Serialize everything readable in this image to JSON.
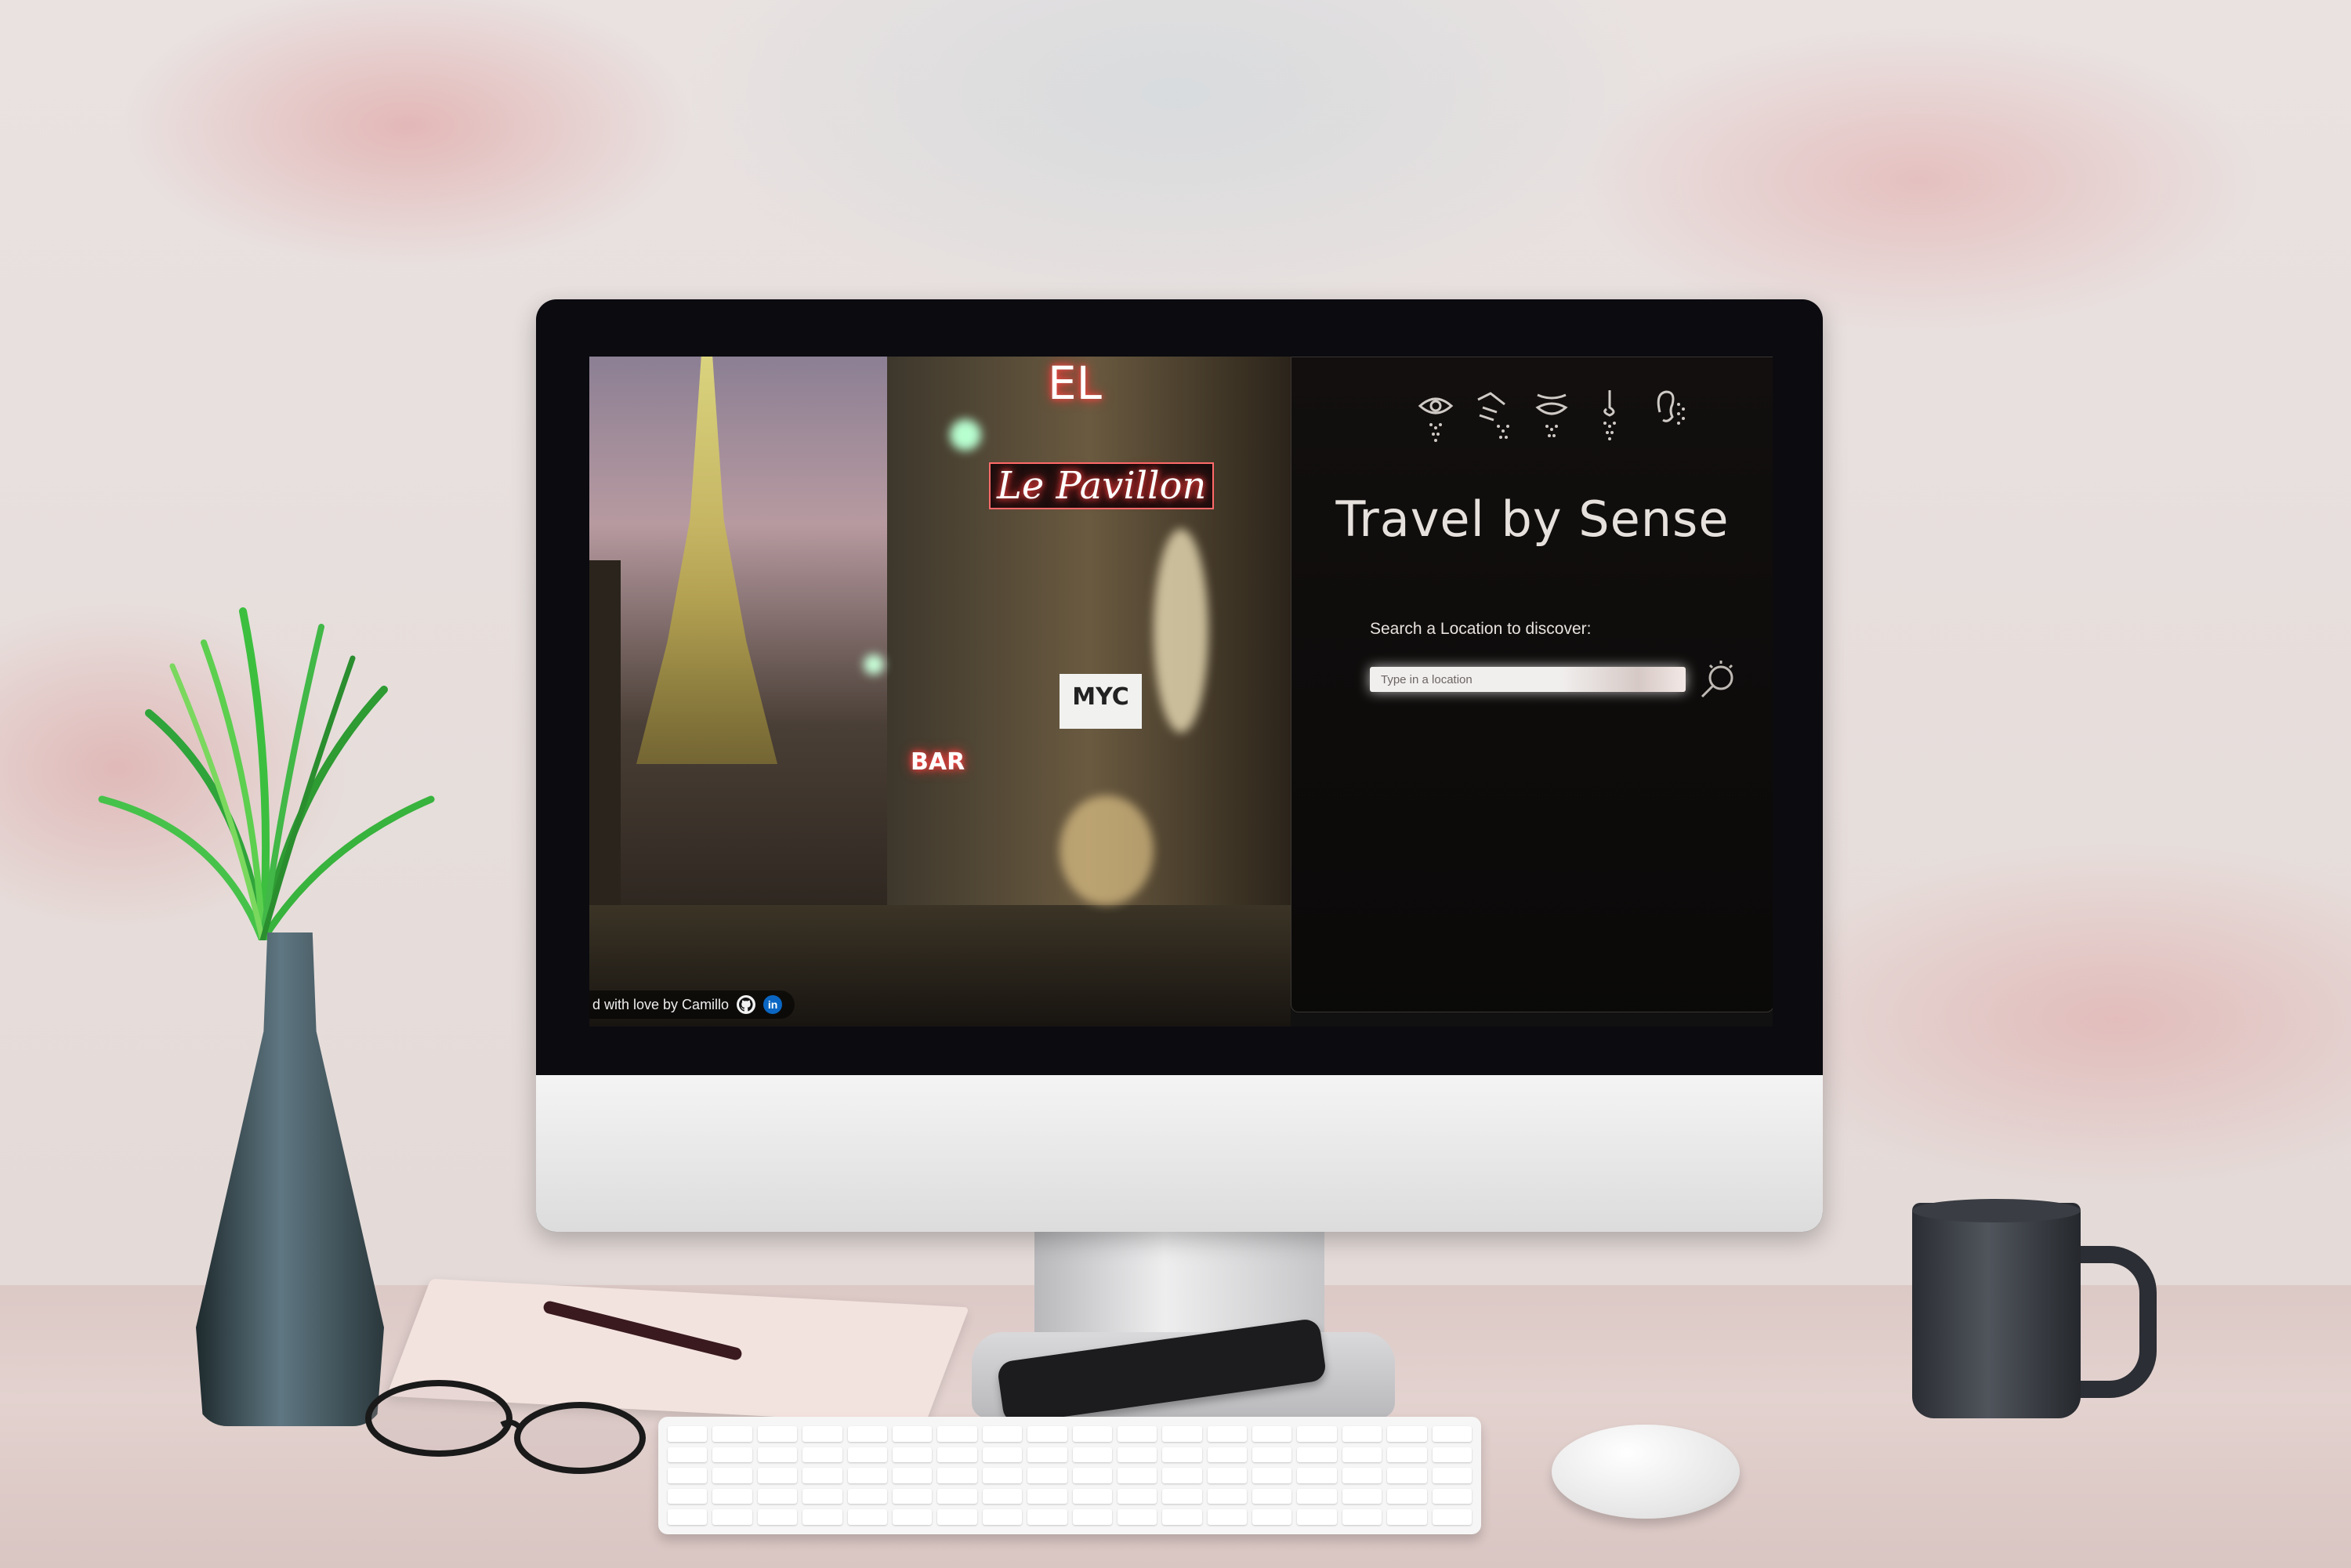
{
  "app": {
    "title": "Travel by Sense",
    "sense_icons": [
      "eye-icon",
      "hand-touch-icon",
      "mouth-taste-icon",
      "nose-smell-icon",
      "ear-hearing-icon"
    ]
  },
  "search": {
    "label": "Search a Location to discover:",
    "placeholder": "Type in a location",
    "button_icon": "magnifier-icon"
  },
  "footer": {
    "credit": "d with love by Camillo",
    "github_icon": "github-icon",
    "linkedin_icon": "linkedin-icon",
    "linkedin_text": "in"
  },
  "photo": {
    "signs": [
      "EL",
      "Le Pavillon",
      "BAR",
      "MYC"
    ]
  },
  "colors": {
    "panel_bg": "#120f0e",
    "title_text": "#e6e1dc",
    "neon_red": "#ff2b2b",
    "linkedin_blue": "#0a66c2"
  }
}
